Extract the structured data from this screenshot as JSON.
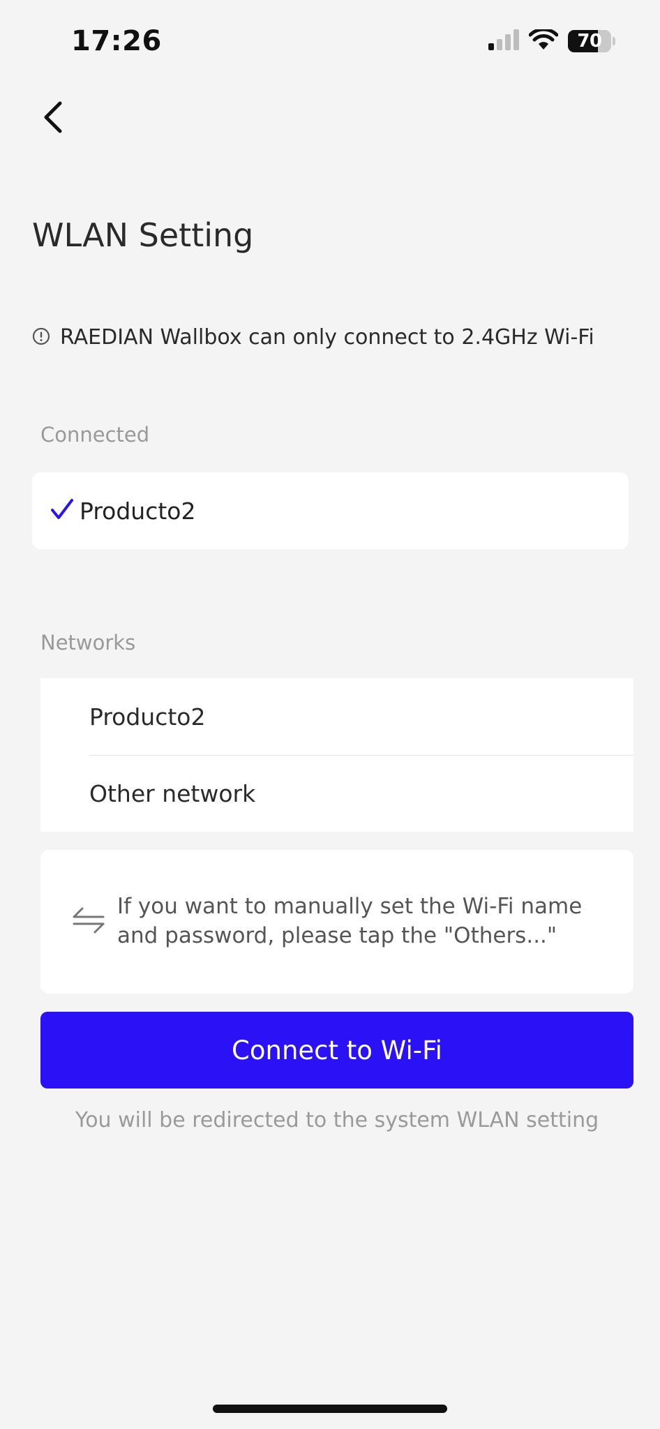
{
  "status_bar": {
    "time": "17:26",
    "battery_level": "70",
    "icons": [
      "cellular-signal-icon",
      "wifi-icon",
      "battery-icon"
    ]
  },
  "header": {
    "back_icon": "chevron-left-icon",
    "title": "WLAN Setting"
  },
  "notice": {
    "icon": "info-circle-icon",
    "text": "RAEDIAN Wallbox can only connect to 2.4GHz Wi-Fi"
  },
  "connected": {
    "label": "Connected",
    "network_name": "Producto2",
    "icon": "checkmark-icon"
  },
  "networks": {
    "label": "Networks",
    "items": [
      {
        "label": "Producto2"
      },
      {
        "label": "Other network"
      }
    ]
  },
  "manual_info": {
    "icon": "swap-arrows-icon",
    "text": "If you want to manually set the Wi-Fi name and password, please tap the \"Others...\""
  },
  "connect_button": {
    "label": "Connect to Wi-Fi"
  },
  "redirect_note": "You will be redirected to the system WLAN setting",
  "colors": {
    "accent": "#2b11f5",
    "background": "#f4f4f4",
    "card": "#ffffff",
    "muted_text": "#999999"
  }
}
